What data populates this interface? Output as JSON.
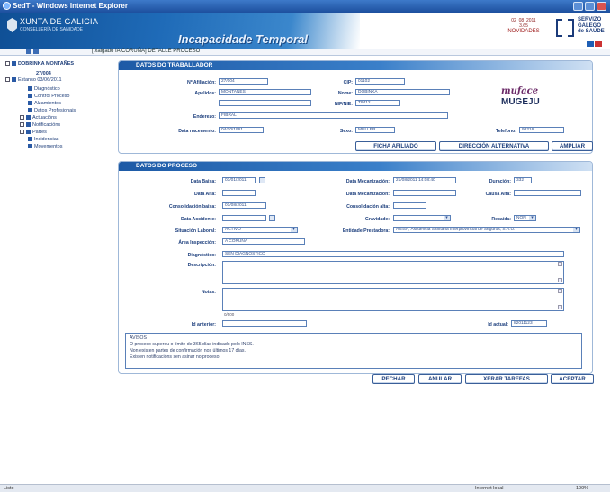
{
  "window": {
    "title": "SedT - Windows Internet Explorer"
  },
  "header": {
    "org": "XUNTA DE GALICIA",
    "consellería": "CONSELLERÍA DE SANIDADE",
    "app_title": "Incapacidade Temporal",
    "novidades_top": "02_08_2011",
    "novidades_mid": "3.65",
    "novidades_main": "NOVIDADES",
    "sergas": [
      "SERVIZO",
      "GALEGO",
      "de SAÚDE"
    ]
  },
  "breadcrumb": "[Ixalgado IA CORUÑA] DETALLE PROCESO",
  "sidebar": {
    "patient": "DOBRINKA MONTAÑES",
    "id": "27/004",
    "process": "Estanso 03/06/2011",
    "items": [
      "Diagnóstico",
      "Control Proceso",
      "Alzamientos",
      "Datos Profesionais",
      "Actuacións",
      "Notificacións",
      "Partes",
      "Incidencias",
      "Movementos"
    ]
  },
  "trabajador": {
    "title": "DATOS DO TRABALLADOR",
    "labels": {
      "afiliacion": "Nº Afiliación:",
      "cip": "CIP:",
      "apelidos": "Apelidos:",
      "nome": "Nome:",
      "nif": "NIF/NIE:",
      "enderezo": "Enderezo:",
      "data_nac": "Data nacemento:",
      "sexo": "Sexo:",
      "telefono": "Telefono:"
    },
    "values": {
      "afiliacion": "27/004",
      "cip": "01102",
      "apelidos": "MONTAÑES",
      "nome": "DOBINKA",
      "nif": "T9412",
      "enderezo": "FIBRAL",
      "data_nac": "04/10/1961",
      "sexo": "MULLER",
      "telefono": "98216"
    },
    "buttons": [
      "FICHA AFILIADO",
      "DIRECCIÓN ALTERNATIVA",
      "AMPLIAR"
    ]
  },
  "logos": {
    "muface": "muface",
    "mugeju": "MUGEJU"
  },
  "proceso": {
    "title": "DATOS DO PROCESO",
    "labels": {
      "data_baixa": "Data Baixa:",
      "data_mec": "Data Mecanización:",
      "duracion": "Duración:",
      "data_alta": "Data Alta:",
      "data_mec2": "Data Mecanización:",
      "causa_alta": "Causa Alta:",
      "consolidacion_baixa": "Consolidación baixa:",
      "consolidacion_alta": "Consolidación alta:",
      "data_accidente": "Data Accidente:",
      "gravidade": "Gravidade:",
      "recaida": "Recaída:",
      "situacion": "Situación Laboral:",
      "entidade": "Entidade Prestadora:",
      "area": "Área Inspección:",
      "diagnostico": "Diagnóstico:",
      "descripcion": "Descripción:",
      "notas": "Notas:",
      "id_anterior": "Id anterior:",
      "id_actual": "Id actual:"
    },
    "values": {
      "data_baixa": "03/01/2011",
      "data_mec": "21/08/2011 14:08:40",
      "duracion": "332",
      "consolidacion_baixa": "01/08/2011",
      "recaida": "NON",
      "situacion": "ACTIVO",
      "entidade": "ASISA, Asistencia Sanitaria Interprovincial de Seguros, S.A.U.",
      "area": "A CORUÑA",
      "diagnostico": "SEN DIAGNÓSTICO",
      "counter": "0/500",
      "id_actual": "82011123"
    },
    "avisos": [
      "AVISOS",
      "O proceso superou o límite de 365 días indicado polo INSS.",
      "Non existen partes de confirmación nos últimos 17 días.",
      "Existen notificacións sen asinar no proceso."
    ],
    "buttons": [
      "PECHAR",
      "ANULAR",
      "XERAR TAREFAS",
      "ACEPTAR"
    ]
  },
  "status": {
    "left": "Listo",
    "zone": "Internet local",
    "zoom": "100%"
  }
}
